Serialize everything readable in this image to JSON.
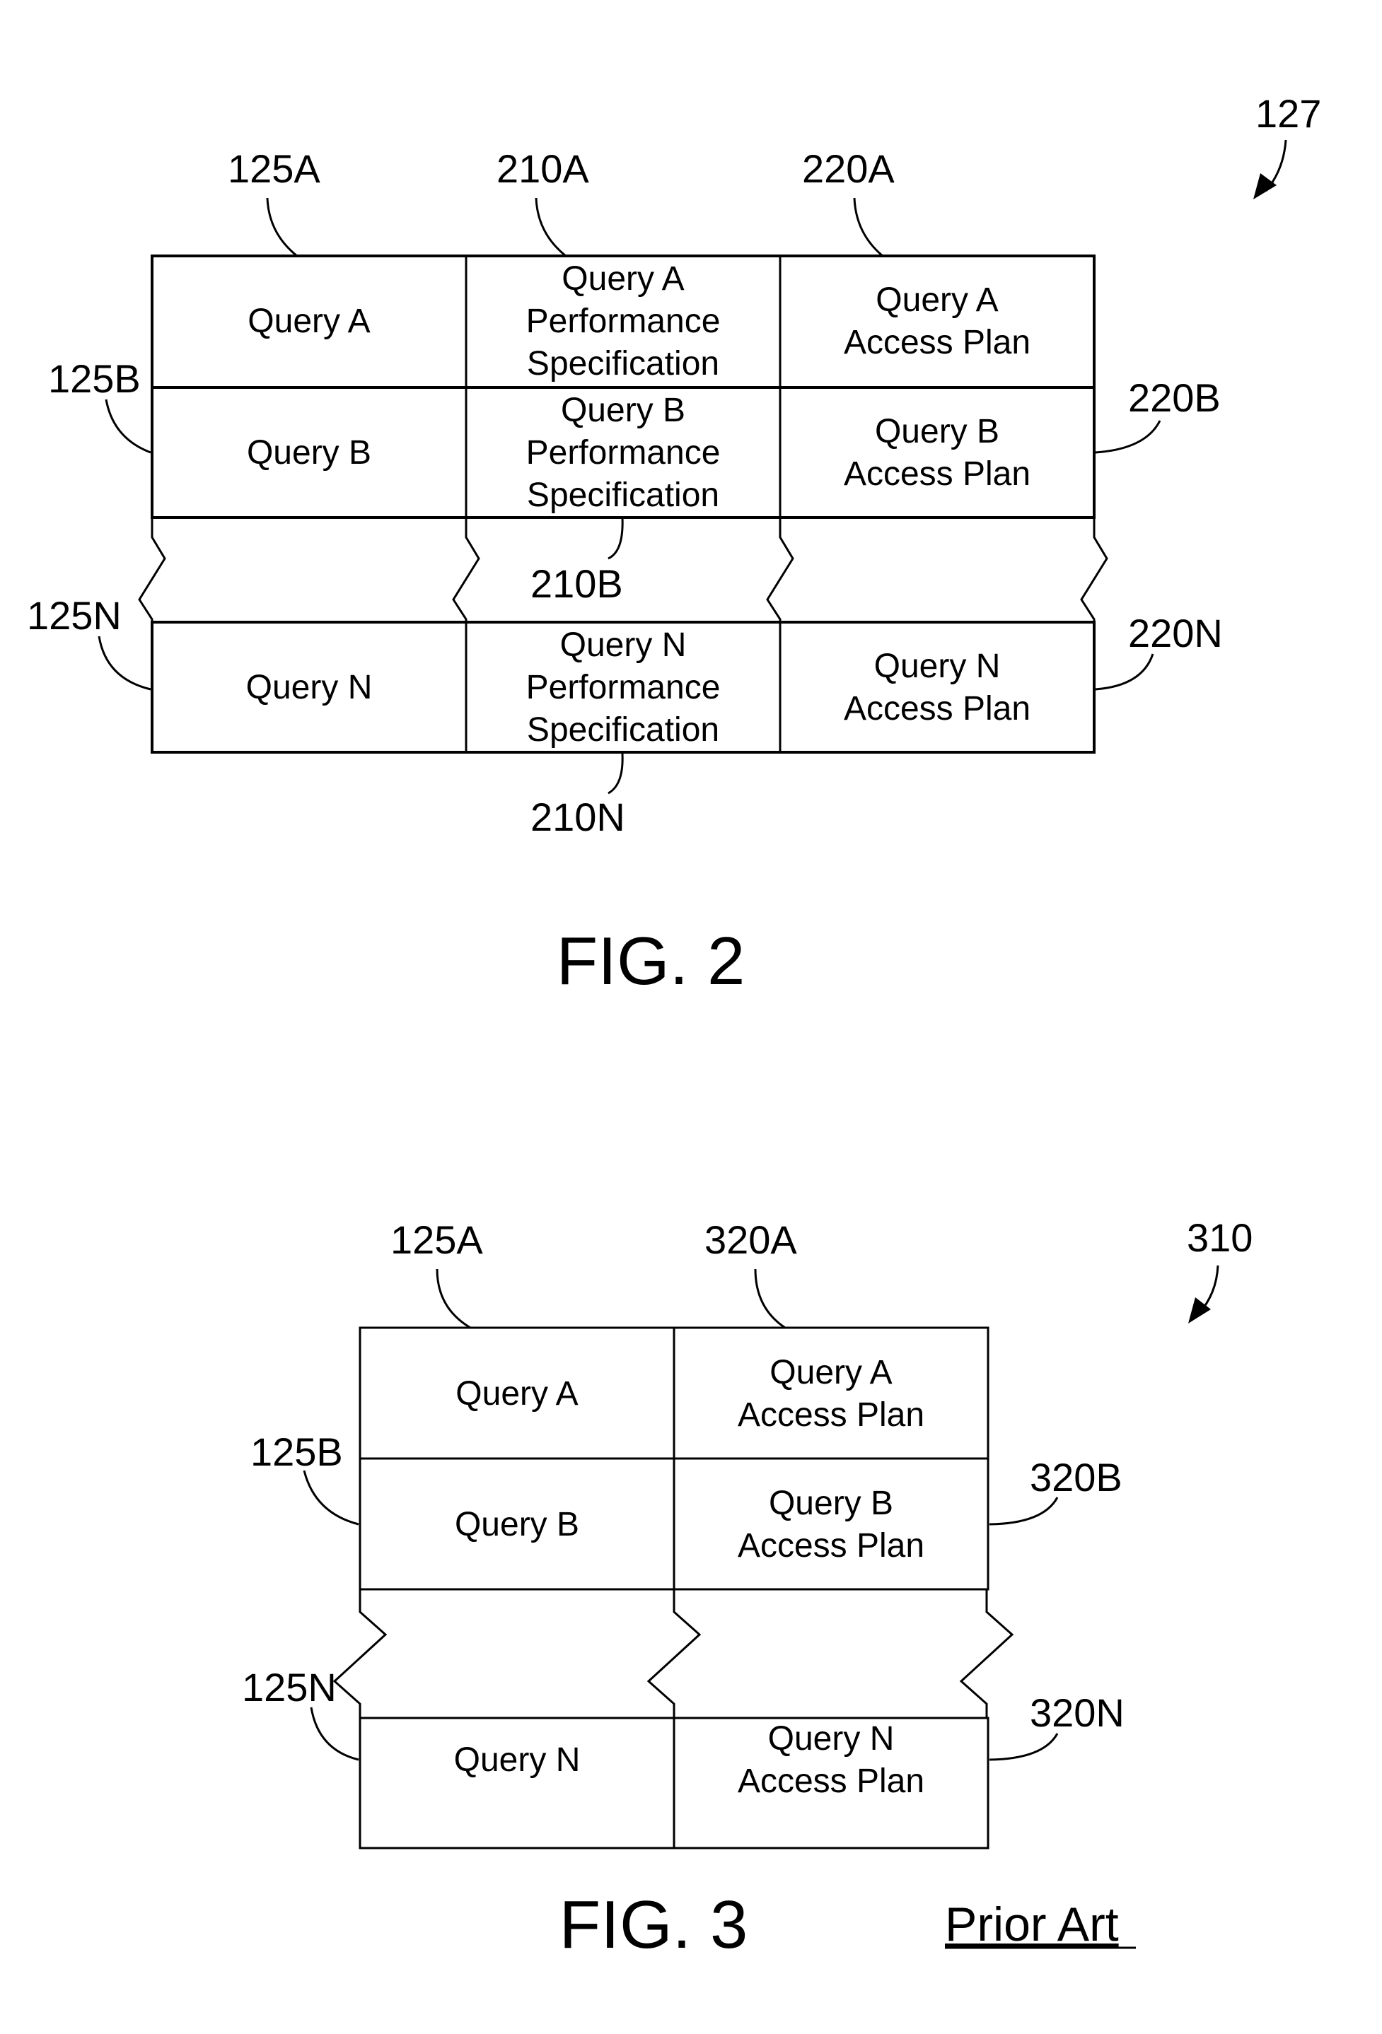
{
  "fig2": {
    "ref_main": "127",
    "col_refs": [
      "125A",
      "210A",
      "220A"
    ],
    "row_refs": {
      "b_left": "125B",
      "b_right": "220B",
      "n_left": "125N",
      "n_right": "220N",
      "b_mid": "210B",
      "n_mid": "210N"
    },
    "rows": [
      [
        "Query A",
        [
          "Query A",
          "Performance",
          "Specification"
        ],
        [
          "Query A",
          "Access Plan"
        ]
      ],
      [
        "Query B",
        [
          "Query B",
          "Performance",
          "Specification"
        ],
        [
          "Query B",
          "Access Plan"
        ]
      ],
      [
        "Query N",
        [
          "Query N",
          "Performance",
          "Specification"
        ],
        [
          "Query N",
          "Access Plan"
        ]
      ]
    ],
    "caption": "FIG. 2"
  },
  "fig3": {
    "ref_main": "310",
    "col_refs": [
      "125A",
      "320A"
    ],
    "row_refs": {
      "b_left": "125B",
      "b_right": "320B",
      "n_left": "125N",
      "n_right": "320N"
    },
    "rows": [
      [
        "Query A",
        [
          "Query A",
          "Access Plan"
        ]
      ],
      [
        "Query B",
        [
          "Query B",
          "Access Plan"
        ]
      ],
      [
        "Query N",
        [
          "Query N",
          "Access Plan"
        ]
      ]
    ],
    "caption": "FIG. 3",
    "note": "Prior Art"
  }
}
